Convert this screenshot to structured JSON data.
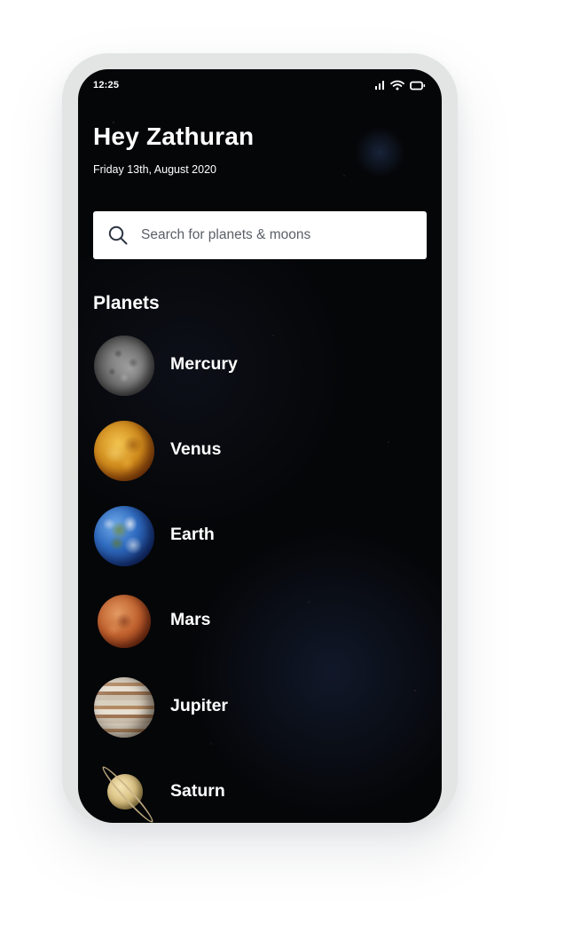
{
  "status_bar": {
    "time": "12:25",
    "icons": [
      "signal-icon",
      "wifi-icon",
      "battery-icon"
    ]
  },
  "header": {
    "greeting": "Hey Zathuran",
    "date": "Friday 13th, August 2020"
  },
  "search": {
    "placeholder": "Search for planets & moons",
    "icon": "search-icon"
  },
  "planets_section": {
    "title": "Planets",
    "items": [
      {
        "label": "Mercury",
        "image": "mercury-image"
      },
      {
        "label": "Venus",
        "image": "venus-image"
      },
      {
        "label": "Earth",
        "image": "earth-image"
      },
      {
        "label": "Mars",
        "image": "mars-image"
      },
      {
        "label": "Jupiter",
        "image": "jupiter-image"
      },
      {
        "label": "Saturn",
        "image": "saturn-image"
      }
    ]
  },
  "colors": {
    "background": "#050608",
    "text": "#ffffff",
    "search_background": "#ffffff",
    "placeholder_text": "#5a5f66",
    "frame": "#e2e5e4"
  }
}
